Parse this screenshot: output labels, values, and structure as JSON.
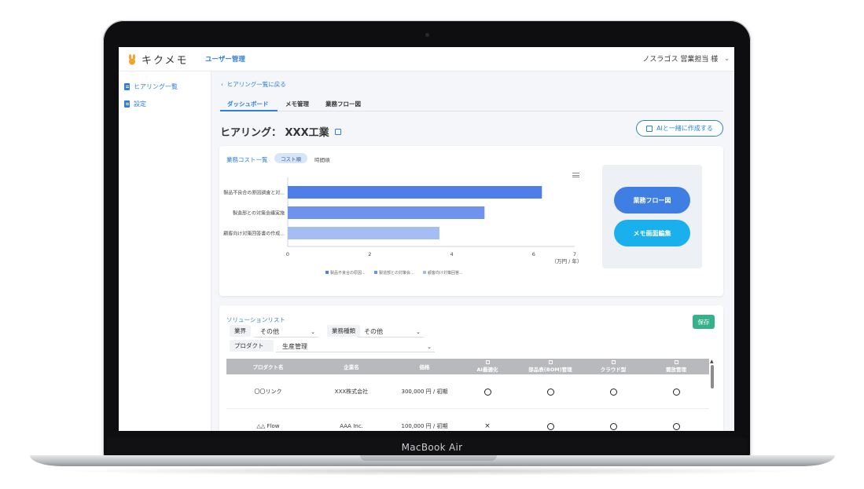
{
  "device": {
    "label": "MacBook Air"
  },
  "app": {
    "logo_text": "キクメモ",
    "nav_user_mgmt": "ユーザー管理",
    "user_name": "ノスラゴス 営業担当 様"
  },
  "sidebar": {
    "items": [
      {
        "label": "ヒアリング一覧"
      },
      {
        "label": "設定"
      }
    ]
  },
  "main": {
    "back_link": "ヒアリング一覧に戻る",
    "tabs": [
      {
        "label": "ダッシュボード",
        "active": true
      },
      {
        "label": "メモ管理",
        "active": false
      },
      {
        "label": "業務フロー図",
        "active": false
      }
    ],
    "page_title": "ヒアリング： XXX工業",
    "ai_button": "AIと一緒に作成する"
  },
  "cost_card": {
    "title": "業務コスト一覧",
    "sort_active": "コスト順",
    "sort_alt": "時間順",
    "panel_buttons": {
      "flow": "業務フロー図",
      "memo": "メモ画面編集"
    }
  },
  "chart_data": {
    "type": "bar",
    "orientation": "horizontal",
    "categories": [
      "製品不良合の原因調査と対...",
      "製造部との対策会議実施",
      "顧客向け対策回答書の作成..."
    ],
    "values": [
      6.2,
      4.8,
      3.7
    ],
    "colors": [
      "#4f7ee8",
      "#6f93ec",
      "#a4bdf3"
    ],
    "xlim": [
      0,
      7
    ],
    "xticks": [
      "0",
      "2",
      "4",
      "6",
      "7"
    ],
    "xlabel": "（万円 / 年）",
    "legend": [
      "製品不良合の原因...",
      "製造部との対策会...",
      "顧客向け対策回答..."
    ],
    "legend_position": "bottom"
  },
  "solution_card": {
    "title": "ソリューションリスト",
    "save_label": "保存",
    "filters": {
      "industry_label": "業界",
      "industry_value": "その他",
      "task_type_label": "業務種類",
      "task_type_value": "その他",
      "product_label": "プロダクト",
      "product_value": "生産管理"
    },
    "columns": [
      "プロダクト名",
      "企業名",
      "価格",
      "AI最適化",
      "部品表(BOM)管理",
      "クラウド型",
      "需放管理"
    ],
    "rows": [
      {
        "product": "〇〇リンク",
        "company": "XXX株式会社",
        "price": "300,000 円 / 初期",
        "marks": [
          "○",
          "○",
          "○",
          "○"
        ]
      },
      {
        "product": "△△ Flow",
        "company": "AAA Inc.",
        "price": "100,000 円 / 初期",
        "marks": [
          "×",
          "○",
          "○",
          "○"
        ]
      }
    ]
  }
}
